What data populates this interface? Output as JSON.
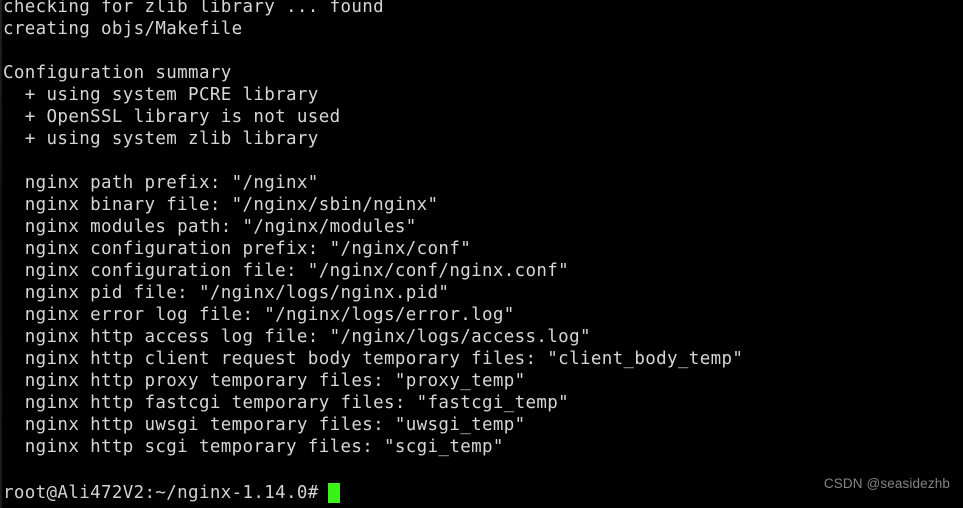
{
  "terminal": {
    "background_color": "#000000",
    "foreground_color": "#d6d6d6",
    "cursor_color": "#3bf218",
    "output_lines": [
      "checking for zlib library ... found",
      "creating objs/Makefile",
      "",
      "Configuration summary",
      "  + using system PCRE library",
      "  + OpenSSL library is not used",
      "  + using system zlib library",
      "",
      "  nginx path prefix: \"/nginx\"",
      "  nginx binary file: \"/nginx/sbin/nginx\"",
      "  nginx modules path: \"/nginx/modules\"",
      "  nginx configuration prefix: \"/nginx/conf\"",
      "  nginx configuration file: \"/nginx/conf/nginx.conf\"",
      "  nginx pid file: \"/nginx/logs/nginx.pid\"",
      "  nginx error log file: \"/nginx/logs/error.log\"",
      "  nginx http access log file: \"/nginx/logs/access.log\"",
      "  nginx http client request body temporary files: \"client_body_temp\"",
      "  nginx http proxy temporary files: \"proxy_temp\"",
      "  nginx http fastcgi temporary files: \"fastcgi_temp\"",
      "  nginx http uwsgi temporary files: \"uwsgi_temp\"",
      "  nginx http scgi temporary files: \"scgi_temp\"",
      ""
    ],
    "prompt": {
      "user": "root",
      "host": "Ali472V2",
      "path": "~/nginx-1.14.0",
      "symbol": "#",
      "full_text": "root@Ali472V2:~/nginx-1.14.0#",
      "command_input": ""
    }
  },
  "watermark": {
    "text": "CSDN @seasidezhb"
  }
}
